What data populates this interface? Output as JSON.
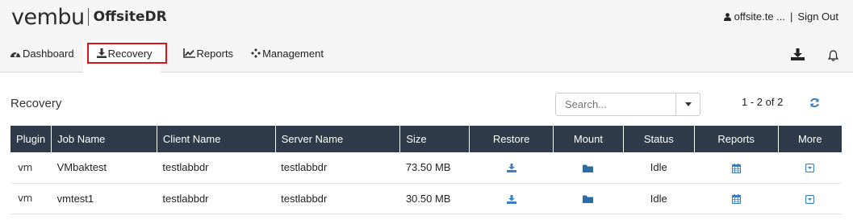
{
  "brand": {
    "logo": "vembu",
    "product": "OffsiteDR"
  },
  "user": {
    "name": "offsite.te ...",
    "separator": "|",
    "signout": "Sign Out"
  },
  "nav": {
    "dashboard": "Dashboard",
    "recovery": "Recovery",
    "reports": "Reports",
    "management": "Management"
  },
  "page": {
    "title": "Recovery"
  },
  "search": {
    "placeholder": "Search..."
  },
  "pager": {
    "range": "1 - 2 of 2"
  },
  "table": {
    "headers": [
      "Plugin",
      "Job Name",
      "Client Name",
      "Server Name",
      "Size",
      "Restore",
      "Mount",
      "Status",
      "Reports",
      "More"
    ],
    "rows": [
      {
        "plugin": "vm",
        "job": "VMbaktest",
        "client": "testlabbdr",
        "server": "testlabbdr",
        "size": "73.50 MB",
        "status": "Idle"
      },
      {
        "plugin": "vm",
        "job": "vmtest1",
        "client": "testlabbdr",
        "server": "testlabbdr",
        "size": "30.50 MB",
        "status": "Idle"
      }
    ]
  },
  "colors": {
    "accent": "#3a7fc1",
    "header_bg": "#2f3a4a",
    "active_border": "#d8151b"
  },
  "icons": [
    "user-icon",
    "dashboard-icon",
    "download-icon",
    "chart-icon",
    "management-icon",
    "bell-icon",
    "caret-down-icon",
    "refresh-icon",
    "folder-icon",
    "calendar-icon",
    "dropdown-box-icon"
  ]
}
